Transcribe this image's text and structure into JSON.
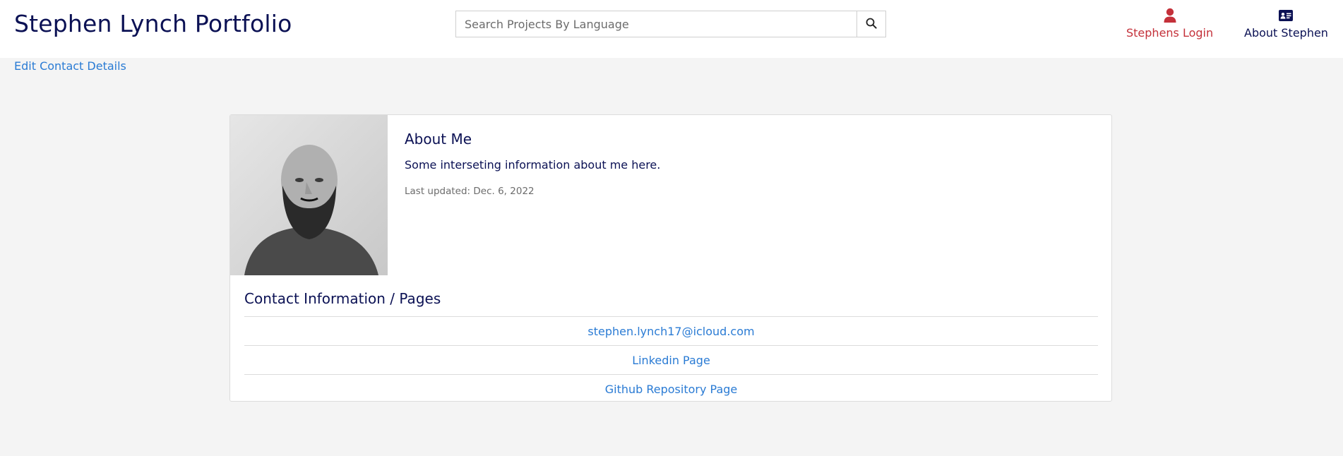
{
  "navbar": {
    "brand": "Stephen Lynch Portfolio",
    "search_placeholder": "Search Projects By Language",
    "search_icon": "search-icon",
    "login_label": "Stephens Login",
    "login_icon": "user-icon",
    "about_label": "About Stephen",
    "about_icon": "id-card-icon"
  },
  "edit_link": "Edit Contact Details",
  "about": {
    "title": "About Me",
    "text": "Some interseting information about me here.",
    "updated": "Last updated: Dec. 6, 2022"
  },
  "contact": {
    "title": "Contact Information / Pages",
    "items": [
      "stephen.lynch17@icloud.com",
      "Linkedin Page",
      "Github Repository Page"
    ]
  },
  "colors": {
    "brand": "#0b1154",
    "link": "#2a7bd4",
    "login": "#c4313a",
    "background": "#f4f4f4"
  }
}
